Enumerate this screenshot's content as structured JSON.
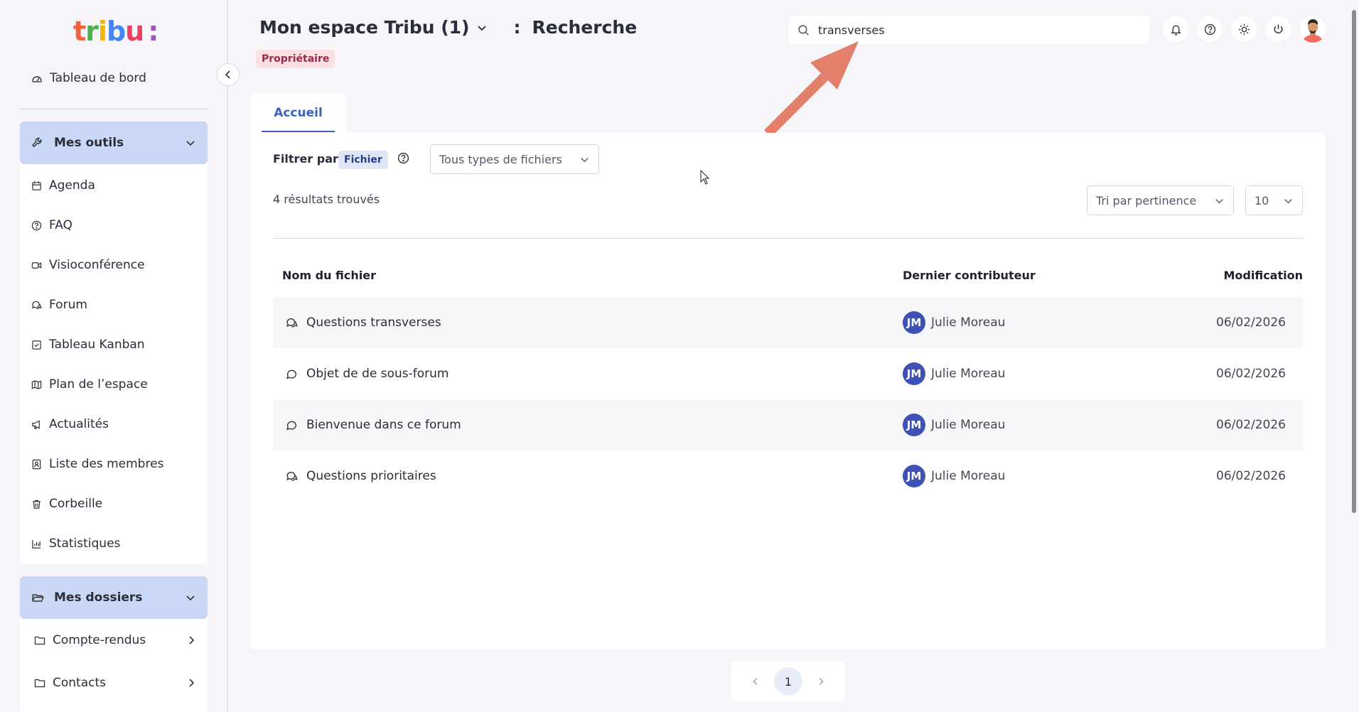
{
  "brand": {
    "letters": [
      {
        "char": "t",
        "color": "#f0643c"
      },
      {
        "char": "r",
        "color": "#4caf50"
      },
      {
        "char": "i",
        "color": "#f4b400"
      },
      {
        "char": "b",
        "color": "#4285f4"
      },
      {
        "char": "u",
        "color": "#e94363"
      },
      {
        "char": ":",
        "color": "#9b59b6"
      }
    ],
    "text": "tribu:"
  },
  "sidebar": {
    "dashboard": "Tableau de bord",
    "tools": {
      "title": "Mes outils",
      "items": [
        {
          "label": "Agenda",
          "icon": "calendar-icon"
        },
        {
          "label": "FAQ",
          "icon": "help-circle-icon"
        },
        {
          "label": "Visioconférence",
          "icon": "video-icon"
        },
        {
          "label": "Forum",
          "icon": "forum-icon"
        },
        {
          "label": "Tableau Kanban",
          "icon": "kanban-check-icon"
        },
        {
          "label": "Plan de l’espace",
          "icon": "map-icon"
        },
        {
          "label": "Actualités",
          "icon": "megaphone-icon"
        },
        {
          "label": "Liste des membres",
          "icon": "member-list-icon"
        },
        {
          "label": "Corbeille",
          "icon": "trash-icon"
        },
        {
          "label": "Statistiques",
          "icon": "bar-chart-icon"
        }
      ]
    },
    "folders": {
      "title": "Mes dossiers",
      "items": [
        {
          "label": "Compte-rendus"
        },
        {
          "label": "Contacts"
        }
      ]
    }
  },
  "header": {
    "space_name": "Mon espace Tribu (1)",
    "separator": ":",
    "section": "Recherche",
    "role_badge": "Propriétaire",
    "search_value": "transverses"
  },
  "tabs": [
    {
      "label": "Accueil",
      "active": true
    }
  ],
  "filters": {
    "label": "Filtrer par:",
    "chip": "Fichier",
    "file_type_select": "Tous types de fichiers",
    "sort_select": "Tri par pertinence",
    "page_size_select": "10"
  },
  "results_count": "4 résultats trouvés",
  "table": {
    "columns": [
      "Nom du fichier",
      "Dernier contributeur",
      "Modification"
    ],
    "rows": [
      {
        "name": "Questions transverses",
        "icon": "forum-icon",
        "initials": "JM",
        "contributor": "Julie Moreau",
        "date": "06/02/2026"
      },
      {
        "name": "Objet de de sous-forum",
        "icon": "comment-icon",
        "initials": "JM",
        "contributor": "Julie Moreau",
        "date": "06/02/2026"
      },
      {
        "name": "Bienvenue dans ce forum",
        "icon": "comment-icon",
        "initials": "JM",
        "contributor": "Julie Moreau",
        "date": "06/02/2026"
      },
      {
        "name": "Questions prioritaires",
        "icon": "forum-icon",
        "initials": "JM",
        "contributor": "Julie Moreau",
        "date": "06/02/2026"
      }
    ]
  },
  "pagination": {
    "current": "1"
  },
  "colors": {
    "accent": "#3d5fc4",
    "section_header": "#c9d8f5",
    "badge_bg": "#fbe0e4",
    "badge_text": "#a3294a",
    "avatar_initials_bg": "#3f51b5",
    "annotation_arrow": "#e3806c"
  }
}
